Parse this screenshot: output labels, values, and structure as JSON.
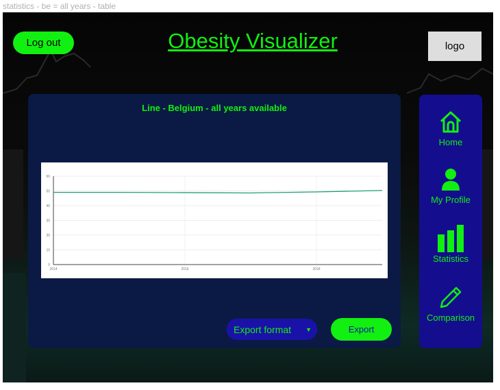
{
  "frame_label": "statistics - be = all years - table",
  "header": {
    "logout_label": "Log out",
    "title": "Obesity Visualizer",
    "logo_label": "logo"
  },
  "panel": {
    "chart_title": "Line - Belgium - all years available",
    "export_format_label": "Export format",
    "export_label": "Export"
  },
  "sidebar": {
    "items": [
      {
        "label": "Home",
        "icon": "home-icon"
      },
      {
        "label": "My Profile",
        "icon": "user-icon"
      },
      {
        "label": "Statistics",
        "icon": "bar-chart-icon"
      },
      {
        "label": "Comparison",
        "icon": "pencil-icon"
      }
    ]
  },
  "colors": {
    "accent": "#11f011",
    "panel_bg": "#0b1a44",
    "sidebar_bg": "#140e8e",
    "line": "#1f9e7a"
  },
  "chart_data": {
    "type": "line",
    "x_ticks": [
      "2014",
      "2016",
      "2018"
    ],
    "y_ticks": [
      "0",
      "10",
      "20",
      "30",
      "40",
      "50",
      "60"
    ],
    "ylim": [
      0,
      60
    ],
    "xlim": [
      2014,
      2019
    ],
    "series": [
      {
        "x": [
          2014,
          2015,
          2016,
          2017,
          2018,
          2019
        ],
        "values": [
          49,
          49,
          48.8,
          48.6,
          49.3,
          50.3
        ]
      }
    ],
    "grid": true
  }
}
